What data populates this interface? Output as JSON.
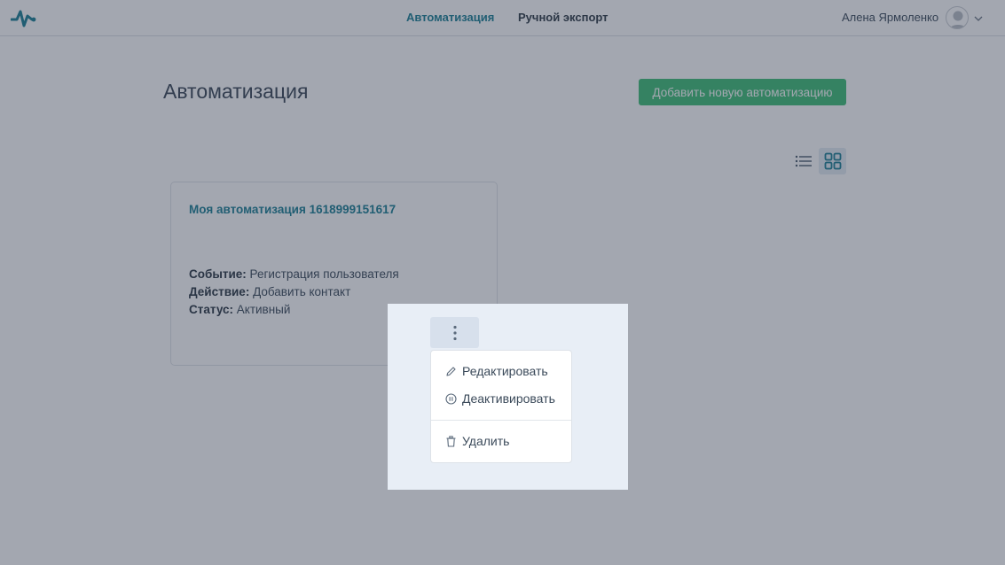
{
  "header": {
    "nav": [
      "Автоматизация",
      "Ручной экспорт"
    ],
    "active_nav": "Автоматизация",
    "user_name": "Алена Ярмоленко"
  },
  "main": {
    "title": "Автоматизация",
    "add_button_label": "Добавить новую автоматизацию",
    "view_modes": [
      "list-icon",
      "grid-icon"
    ],
    "active_view": "grid-icon"
  },
  "card": {
    "title": "Моя автоматизация 1618999151617",
    "event_label": "Событие:",
    "event_value": "Регистрация пользователя",
    "action_label": "Действие:",
    "action_value": "Добавить контакт",
    "status_label": "Статус:",
    "status_value": "Активный"
  },
  "context_menu": {
    "items": [
      {
        "label": "Редактировать",
        "icon": "pencil-icon"
      },
      {
        "label": "Деактивировать",
        "icon": "pause-circle-icon"
      },
      {
        "label": "Удалить",
        "icon": "trash-icon"
      }
    ]
  },
  "colors": {
    "accent": "#1b7f95",
    "button_green": "#3fbf76",
    "overlay": "#2a3448"
  }
}
